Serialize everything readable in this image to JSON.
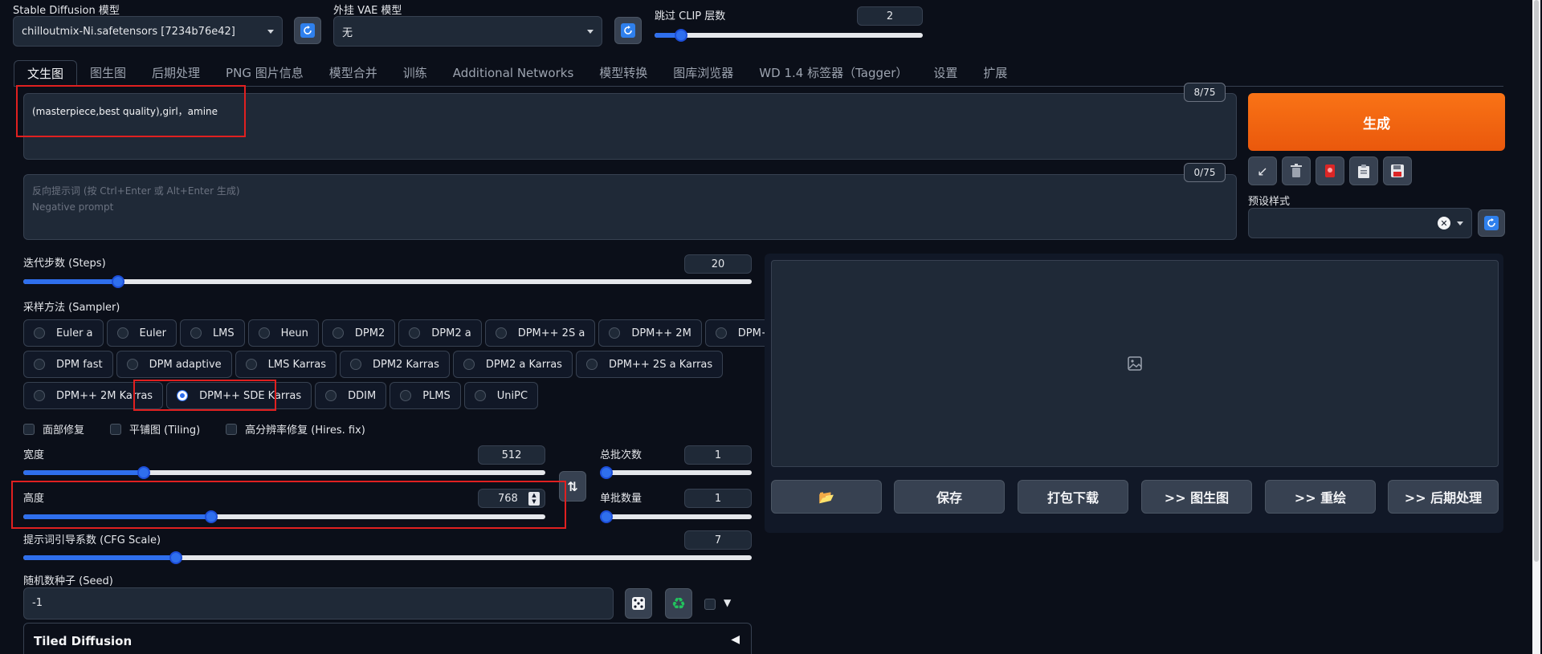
{
  "top": {
    "sd_model_label": "Stable Diffusion 模型",
    "sd_model_value": "chilloutmix-Ni.safetensors [7234b76e42]",
    "vae_label": "外挂 VAE 模型",
    "vae_value": "无",
    "clip_label": "跳过 CLIP 层数",
    "clip_value": "2",
    "clip_level": 0.1
  },
  "tabs": [
    "文生图",
    "图生图",
    "后期处理",
    "PNG 图片信息",
    "模型合并",
    "训练",
    "Additional Networks",
    "模型转换",
    "图库浏览器",
    "WD 1.4 标签器（Tagger）",
    "设置",
    "扩展"
  ],
  "prompt": {
    "text": "(masterpiece,best quality),girl，amine",
    "counter": "8/75"
  },
  "negative": {
    "placeholder": "反向提示词 (按 Ctrl+Enter 或 Alt+Enter 生成)\nNegative prompt",
    "counter": "0/75"
  },
  "generate": {
    "label": "生成",
    "preset_label": "预设样式",
    "accent": "#f97316"
  },
  "steps": {
    "label": "迭代步数 (Steps)",
    "value": "20",
    "level": 0.13
  },
  "sampler": {
    "label": "采样方法 (Sampler)",
    "options": [
      "Euler a",
      "Euler",
      "LMS",
      "Heun",
      "DPM2",
      "DPM2 a",
      "DPM++ 2S a",
      "DPM++ 2M",
      "DPM++ SDE",
      "DPM fast",
      "DPM adaptive",
      "LMS Karras",
      "DPM2 Karras",
      "DPM2 a Karras",
      "DPM++ 2S a Karras",
      "DPM++ 2M Karras",
      "DPM++ SDE Karras",
      "DDIM",
      "PLMS",
      "UniPC"
    ],
    "selected": "DPM++ SDE Karras"
  },
  "checks": {
    "face": "面部修复",
    "tiling": "平铺图 (Tiling)",
    "hires": "高分辨率修复 (Hires. fix)"
  },
  "width": {
    "label": "宽度",
    "value": "512",
    "level": 0.23
  },
  "height": {
    "label": "高度",
    "value": "768",
    "level": 0.36
  },
  "batch_count": {
    "label": "总批次数",
    "value": "1",
    "level": 0.0
  },
  "batch_size": {
    "label": "单批数量",
    "value": "1",
    "level": 0.0
  },
  "cfg": {
    "label": "提示词引导系数 (CFG Scale)",
    "value": "7",
    "level": 0.21
  },
  "seed": {
    "label": "随机数种子 (Seed)",
    "value": "-1"
  },
  "tiled": {
    "label": "Tiled Diffusion",
    "arrow": "◀"
  },
  "actions": {
    "folder": "📂",
    "save": "保存",
    "zip": "打包下载",
    "to_img2img": ">> 图生图",
    "to_inpaint": ">> 重绘",
    "to_extras": ">> 后期处理"
  }
}
